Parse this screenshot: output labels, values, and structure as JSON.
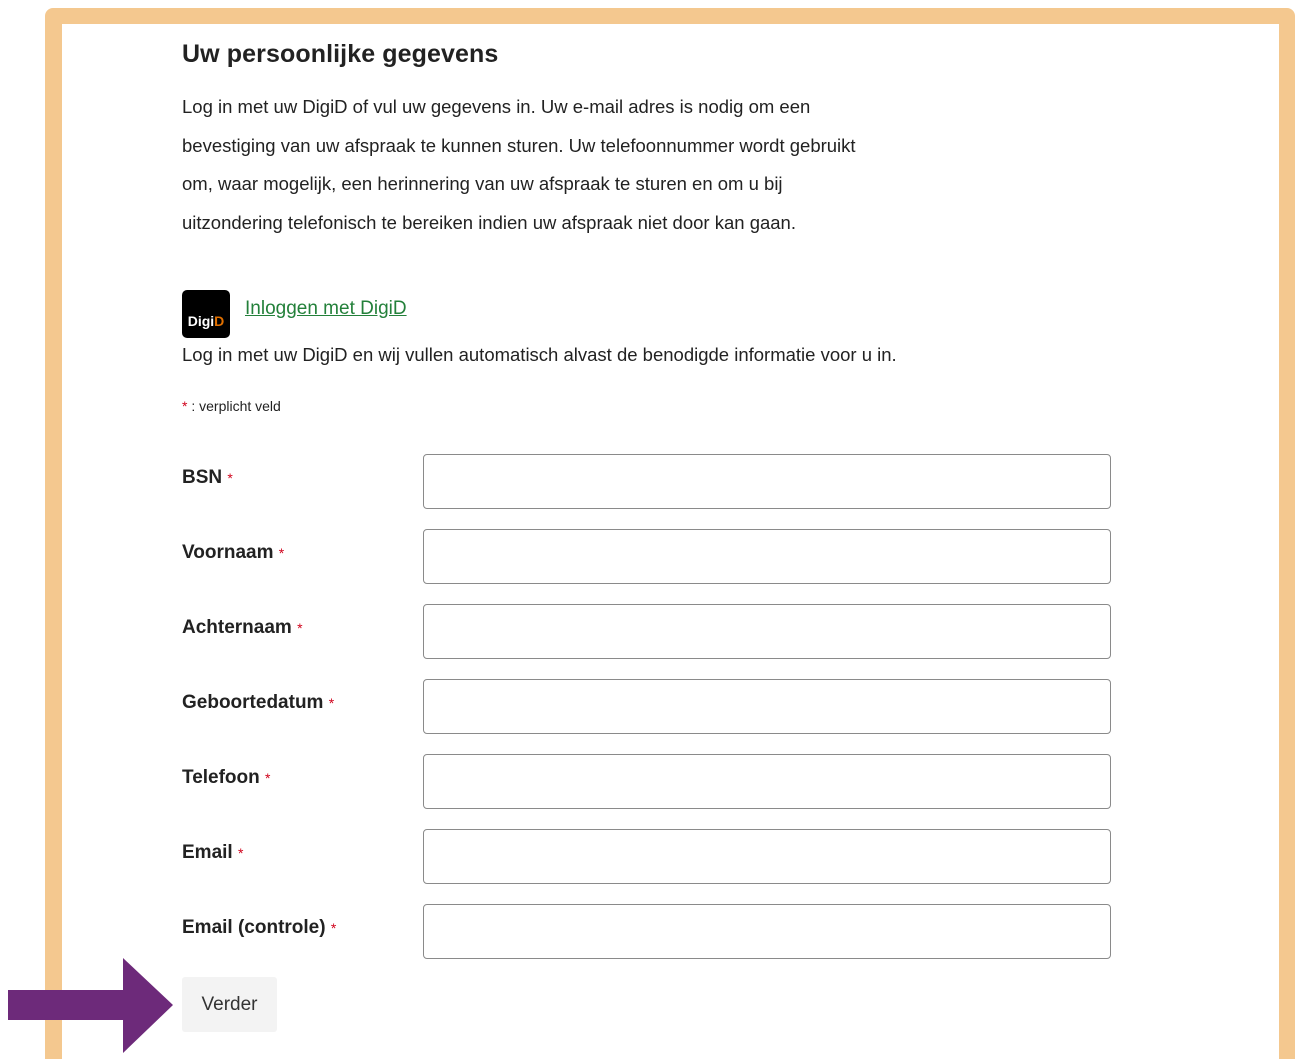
{
  "heading": "Uw persoonlijke gegevens",
  "intro": "Log in met uw DigiD of vul uw gegevens in. Uw e-mail adres is nodig om een bevestiging van uw afspraak te kunnen sturen. Uw telefoonnummer wordt gebruikt om, waar mogelijk, een herinnering van uw afspraak te sturen en om u bij uitzondering telefonisch te bereiken indien uw afspraak niet door kan gaan.",
  "intro_lines": [
    "Log in met uw DigiD of vul uw gegevens in. Uw e-mail adres is nodig om een",
    "bevestiging van uw afspraak te kunnen sturen. Uw telefoonnummer wordt gebruikt",
    "om, waar mogelijk, een herinnering van uw afspraak te sturen en om u bij",
    "uitzondering telefonisch te bereiken indien uw afspraak niet door kan gaan."
  ],
  "digid": {
    "logo_text_a": "Digi",
    "logo_text_b": "D",
    "link_label": "Inloggen met DigiD",
    "description": "Log in met uw DigiD en wij vullen automatisch alvast de benodigde informatie voor u in."
  },
  "required_note": {
    "star": "*",
    "text": " : verplicht veld"
  },
  "fields": [
    {
      "label": "BSN",
      "value": ""
    },
    {
      "label": "Voornaam",
      "value": ""
    },
    {
      "label": "Achternaam",
      "value": ""
    },
    {
      "label": "Geboortedatum",
      "value": ""
    },
    {
      "label": "Telefoon",
      "value": ""
    },
    {
      "label": "Email",
      "value": ""
    },
    {
      "label": "Email (controle)",
      "value": ""
    }
  ],
  "required_star": "*",
  "submit_label": "Verder",
  "colors": {
    "frame": "#f4c88f",
    "link": "#23803a",
    "required": "#d0021b",
    "arrow": "#6d2a7a"
  },
  "annotation_arrow_icon": "arrow-right-icon"
}
